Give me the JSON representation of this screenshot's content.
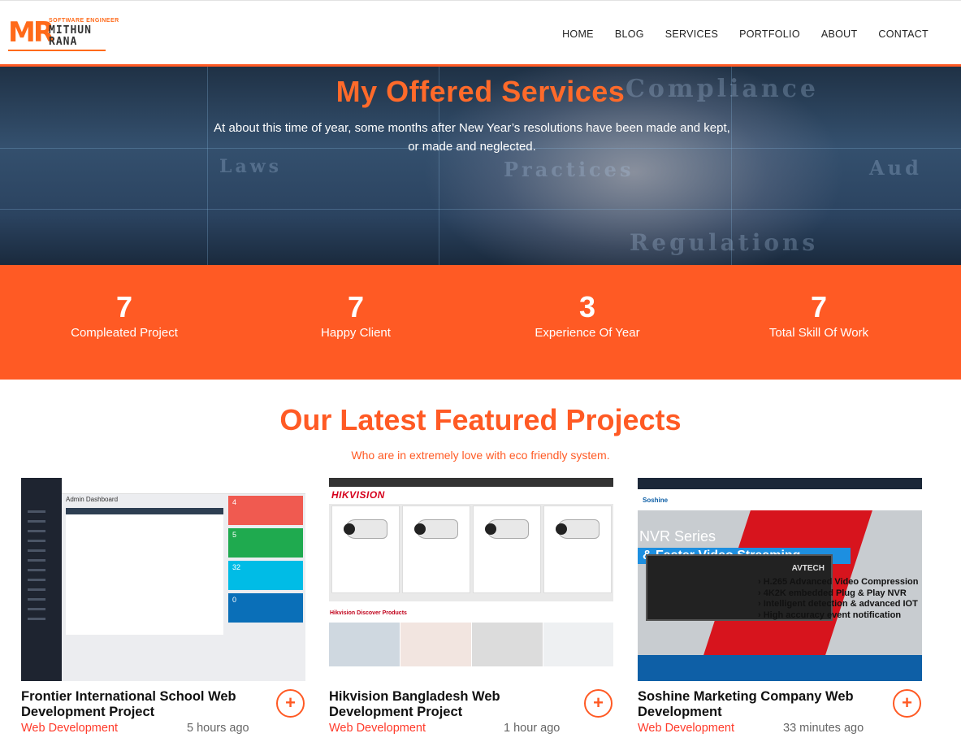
{
  "header": {
    "logo": {
      "mark": "MR",
      "tagline": "SOFTWARE ENGINEER",
      "name_line1": "MITHUN",
      "name_line2": "RANA"
    },
    "nav": [
      "HOME",
      "BLOG",
      "SERVICES",
      "PORTFOLIO",
      "ABOUT",
      "CONTACT"
    ]
  },
  "hero": {
    "title": "My Offered Services",
    "text": "At about this time of year, some months after New Year’s resolutions have been made and kept, or made and neglected.",
    "background_words": [
      "Compliance",
      "Laws",
      "Practices",
      "Aud",
      "Regulations"
    ]
  },
  "stats": [
    {
      "value": "7",
      "label": "Compleated Project"
    },
    {
      "value": "7",
      "label": "Happy Client"
    },
    {
      "value": "3",
      "label": "Experience Of Year"
    },
    {
      "value": "7",
      "label": "Total Skill Of Work"
    }
  ],
  "projects_section": {
    "title": "Our Latest Featured Projects",
    "subtitle": "Who are in extremely love with eco friendly system."
  },
  "projects": [
    {
      "title": "Frontier International School Web Development Project",
      "category": "Web Development",
      "time": "5 hours ago",
      "thumb_labels": {
        "heading": "Admin Dashboard",
        "box1_value": "4",
        "box2_value": "5",
        "box3_value": "32",
        "box4_value": "0"
      }
    },
    {
      "title": "Hikvision Bangladesh Web Development Project",
      "category": "Web Development",
      "time": "1 hour ago",
      "thumb_labels": {
        "brand": "HIKVISION",
        "section": "Hikvision Discover Products"
      }
    },
    {
      "title": "Soshine Marketing Company Web Development",
      "category": "Web Development",
      "time": "33 minutes ago",
      "thumb_labels": {
        "brand": "Soshine",
        "banner_title": "NVR Series",
        "banner_strip": "& Faster Video Streaming",
        "bullets": [
          "› H.265 Advanced Video Compression",
          "› 4K2K embedded Plug & Play NVR",
          "› Intelligent detection & advanced IOT",
          "› High accuracy event notification"
        ],
        "device_brand": "AVTECH"
      }
    }
  ],
  "colors": {
    "accent": "#ff5a24",
    "dark": "#1e2430",
    "white": "#ffffff"
  },
  "icons": {
    "plus": "plus-icon"
  }
}
